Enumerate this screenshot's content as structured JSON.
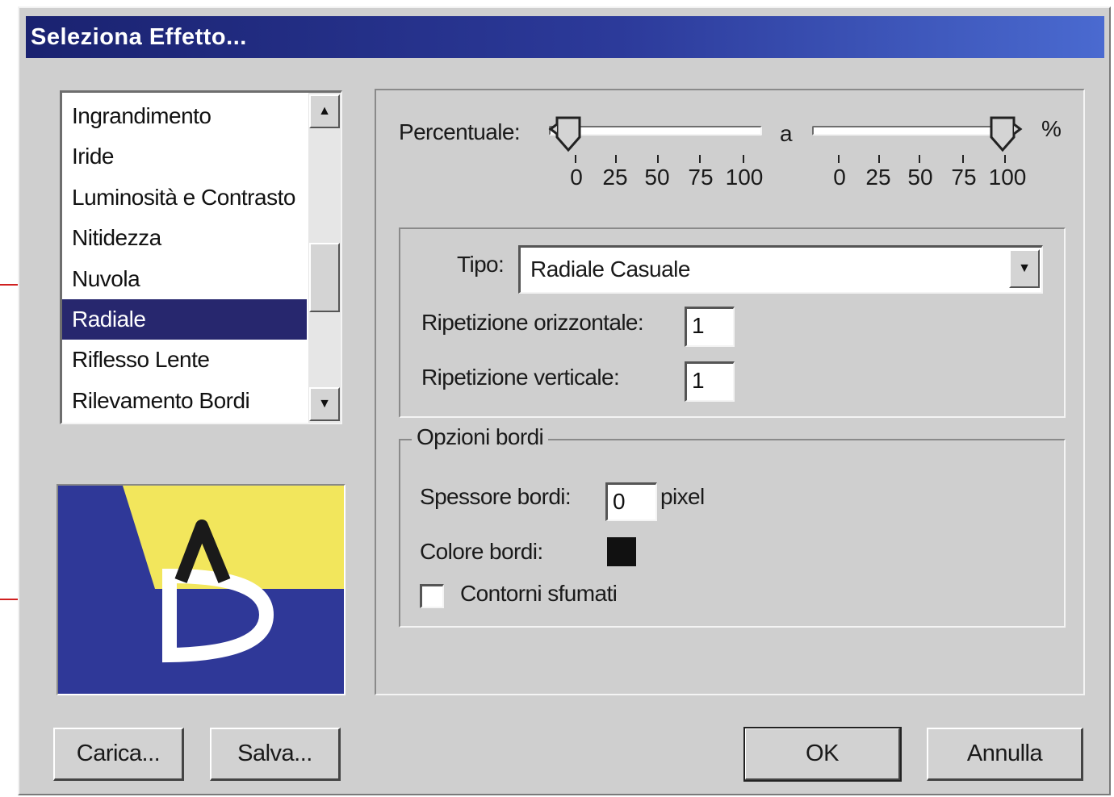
{
  "window": {
    "title": "Seleziona Effetto..."
  },
  "effects_list": {
    "items": [
      {
        "label": "Ingrandimento"
      },
      {
        "label": "Iride"
      },
      {
        "label": "Luminosità e Contrasto"
      },
      {
        "label": "Nitidezza"
      },
      {
        "label": "Nuvola"
      },
      {
        "label": "Radiale"
      },
      {
        "label": "Riflesso Lente"
      },
      {
        "label": "Rilevamento Bordi"
      }
    ],
    "selected": "Radiale"
  },
  "percent": {
    "label": "Percentuale:",
    "separator": "a",
    "unit": "%",
    "from_value": 0,
    "to_value": 100,
    "ticks": [
      "0",
      "25",
      "50",
      "75",
      "100"
    ]
  },
  "type_group": {
    "type_label": "Tipo:",
    "type_value": "Radiale Casuale",
    "h_rep_label": "Ripetizione orizzontale:",
    "h_rep_value": "1",
    "v_rep_label": "Ripetizione verticale:",
    "v_rep_value": "1"
  },
  "border_options": {
    "legend": "Opzioni bordi",
    "thickness_label": "Spessore bordi:",
    "thickness_value": "0",
    "thickness_unit": "pixel",
    "color_label": "Colore bordi:",
    "color_value": "#111111",
    "feather_label": "Contorni sfumati",
    "feather_checked": false
  },
  "buttons": {
    "load": "Carica...",
    "save": "Salva...",
    "ok": "OK",
    "cancel": "Annulla"
  },
  "colors": {
    "title_bar": "#1a2270",
    "selection": "#27276e",
    "preview_blue": "#2f3898",
    "preview_yellow": "#f2e65c"
  }
}
